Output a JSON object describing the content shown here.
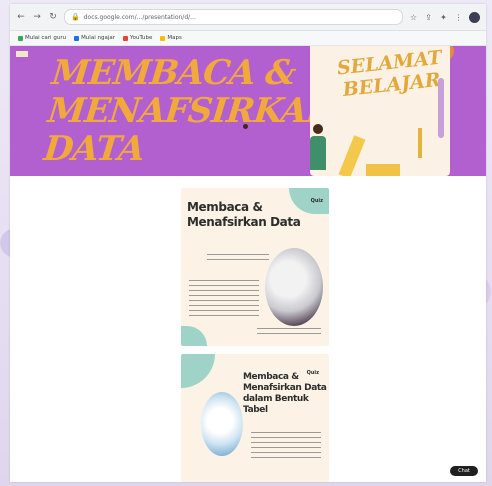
{
  "browser": {
    "url": "docs.google.com/.../presentation/d/...",
    "bookmarks": [
      {
        "label": "Mulai cari guru",
        "color": "#34a853"
      },
      {
        "label": "Mulai ngajar",
        "color": "#1a73e8"
      },
      {
        "label": "YouTube",
        "color": "#ea4335"
      },
      {
        "label": "Maps",
        "color": "#fbbc04"
      }
    ]
  },
  "banner": {
    "title_line1": "MEMBACA &",
    "title_line2": "MENAFSIRKAN",
    "title_line3": "DATA",
    "card_line1": "SELAMAT",
    "card_line2": "BELAJAR"
  },
  "slides": [
    {
      "title_line1": "Membaca &",
      "title_line2": "Menafsirkan Data",
      "tag": "Quiz"
    },
    {
      "title_line1": "Membaca &",
      "title_line2": "Menafsirkan Data",
      "title_line3": "dalam Bentuk Tabel",
      "tag": "Quiz"
    }
  ],
  "chat_button": "Chat"
}
